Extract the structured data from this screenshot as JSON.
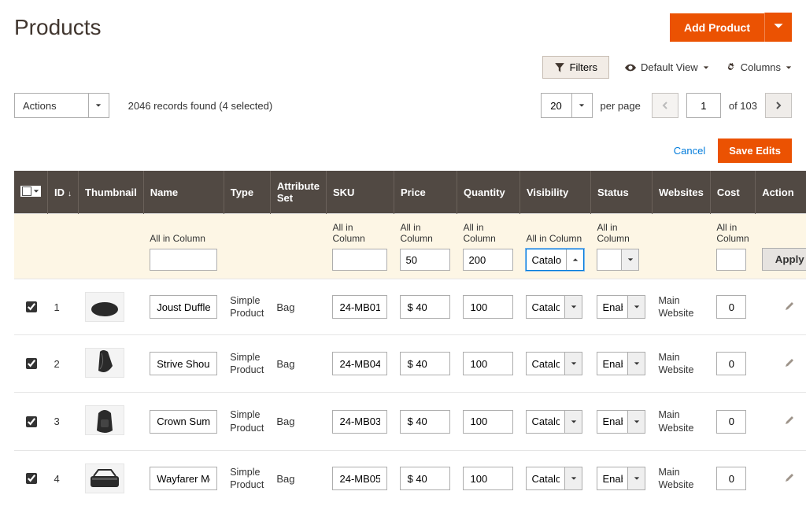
{
  "page_title": "Products",
  "add_button": "Add Product",
  "filters_label": "Filters",
  "default_view_label": "Default View",
  "columns_label": "Columns",
  "actions_label": "Actions",
  "records_text": "2046 records found (4 selected)",
  "page_size": "20",
  "per_page_label": "per page",
  "current_page": "1",
  "total_pages_text": "of 103",
  "cancel_label": "Cancel",
  "save_label": "Save Edits",
  "apply_label": "Apply",
  "headers": {
    "id": "ID",
    "thumbnail": "Thumbnail",
    "name": "Name",
    "type": "Type",
    "attribute_set": "Attribute Set",
    "sku": "SKU",
    "price": "Price",
    "quantity": "Quantity",
    "visibility": "Visibility",
    "status": "Status",
    "websites": "Websites",
    "cost": "Cost",
    "action": "Action"
  },
  "filter_label": "All in Column",
  "filters": {
    "name": "",
    "sku": "",
    "price": "50",
    "quantity": "200",
    "visibility": "Catalog",
    "status": "",
    "cost": ""
  },
  "rows": [
    {
      "checked": true,
      "id": "1",
      "name": "Joust Duffle Bag",
      "type": "Simple Product",
      "attr": "Bag",
      "sku": "24-MB01",
      "price": "$ 40",
      "qty": "100",
      "visibility": "Catalog",
      "status": "Enabled",
      "websites": "Main Website",
      "cost": "0"
    },
    {
      "checked": true,
      "id": "2",
      "name": "Strive Shoulder Pack",
      "type": "Simple Product",
      "attr": "Bag",
      "sku": "24-MB04",
      "price": "$ 40",
      "qty": "100",
      "visibility": "Catalog",
      "status": "Enabled",
      "websites": "Main Website",
      "cost": "0"
    },
    {
      "checked": true,
      "id": "3",
      "name": "Crown Summit Backpack",
      "type": "Simple Product",
      "attr": "Bag",
      "sku": "24-MB03",
      "price": "$ 40",
      "qty": "100",
      "visibility": "Catalog",
      "status": "Enabled",
      "websites": "Main Website",
      "cost": "0"
    },
    {
      "checked": true,
      "id": "4",
      "name": "Wayfarer Messenger Bag",
      "type": "Simple Product",
      "attr": "Bag",
      "sku": "24-MB05",
      "price": "$ 40",
      "qty": "100",
      "visibility": "Catalog",
      "status": "Enabled",
      "websites": "Main Website",
      "cost": "0"
    }
  ],
  "thumb_svgs": [
    "duffel",
    "pouch",
    "backpack",
    "messenger"
  ]
}
